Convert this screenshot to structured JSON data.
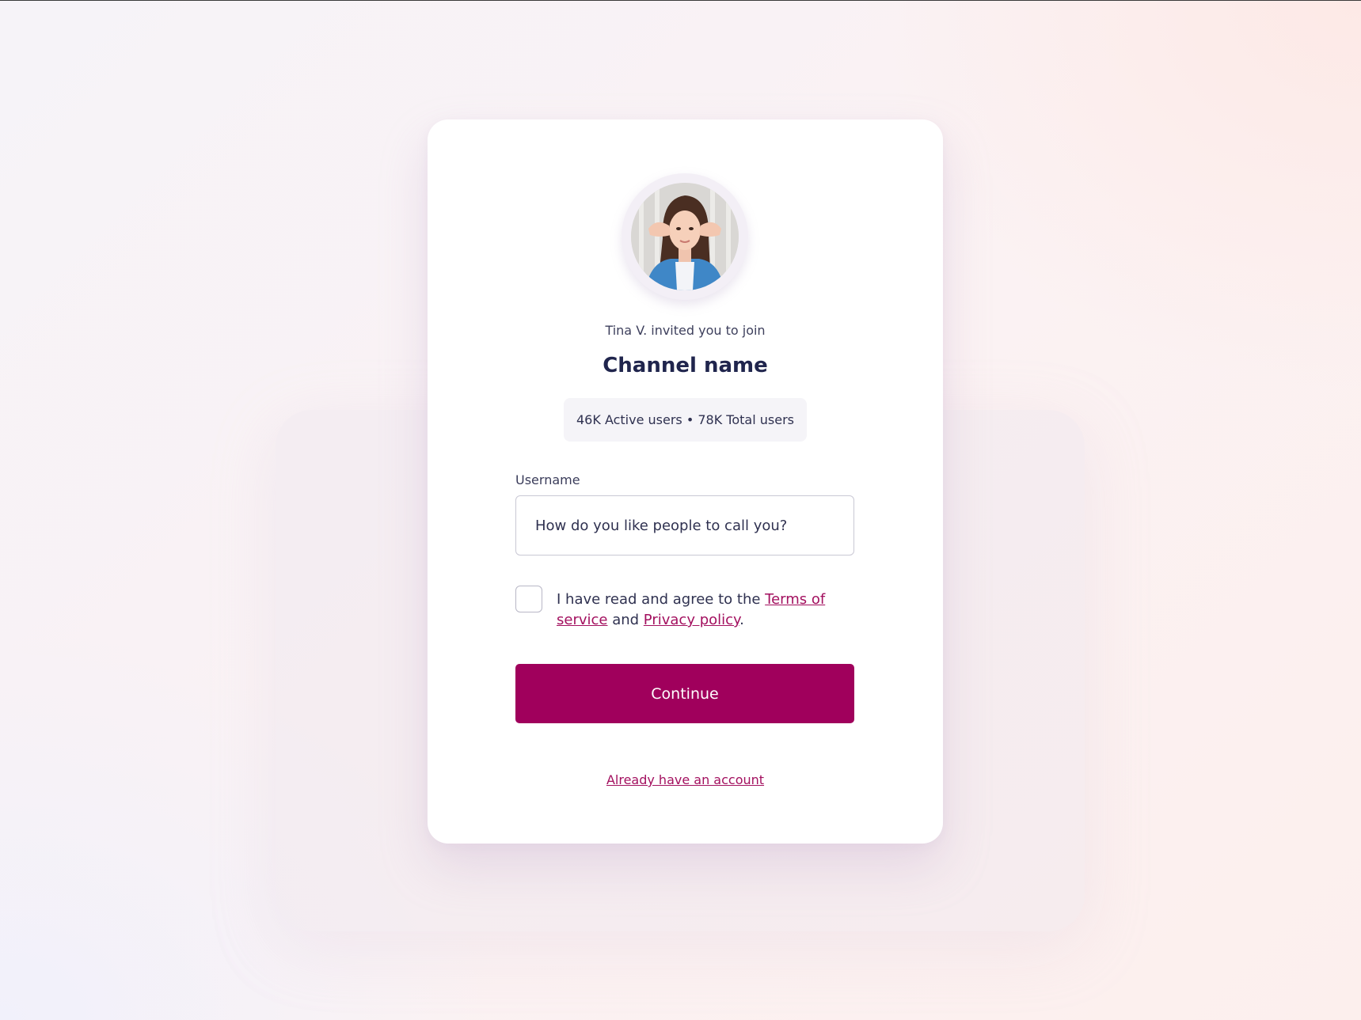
{
  "invite": {
    "message": "Tina V. invited you to join",
    "channel_name": "Channel name",
    "stats": "46K Active users • 78K Total users",
    "avatar_icon": "profile-photo"
  },
  "form": {
    "username_label": "Username",
    "username_placeholder": "How do you like people to call you?",
    "username_value": "",
    "agree_prefix": "I have read and agree to the ",
    "terms_link": "Terms of service",
    "agree_and": " and ",
    "privacy_link": "Privacy policy",
    "agree_suffix": ".",
    "agree_checked": false,
    "continue_label": "Continue",
    "login_link": "Already have an account"
  },
  "colors": {
    "accent": "#a0005c",
    "link": "#a3105f",
    "heading": "#20254d"
  }
}
